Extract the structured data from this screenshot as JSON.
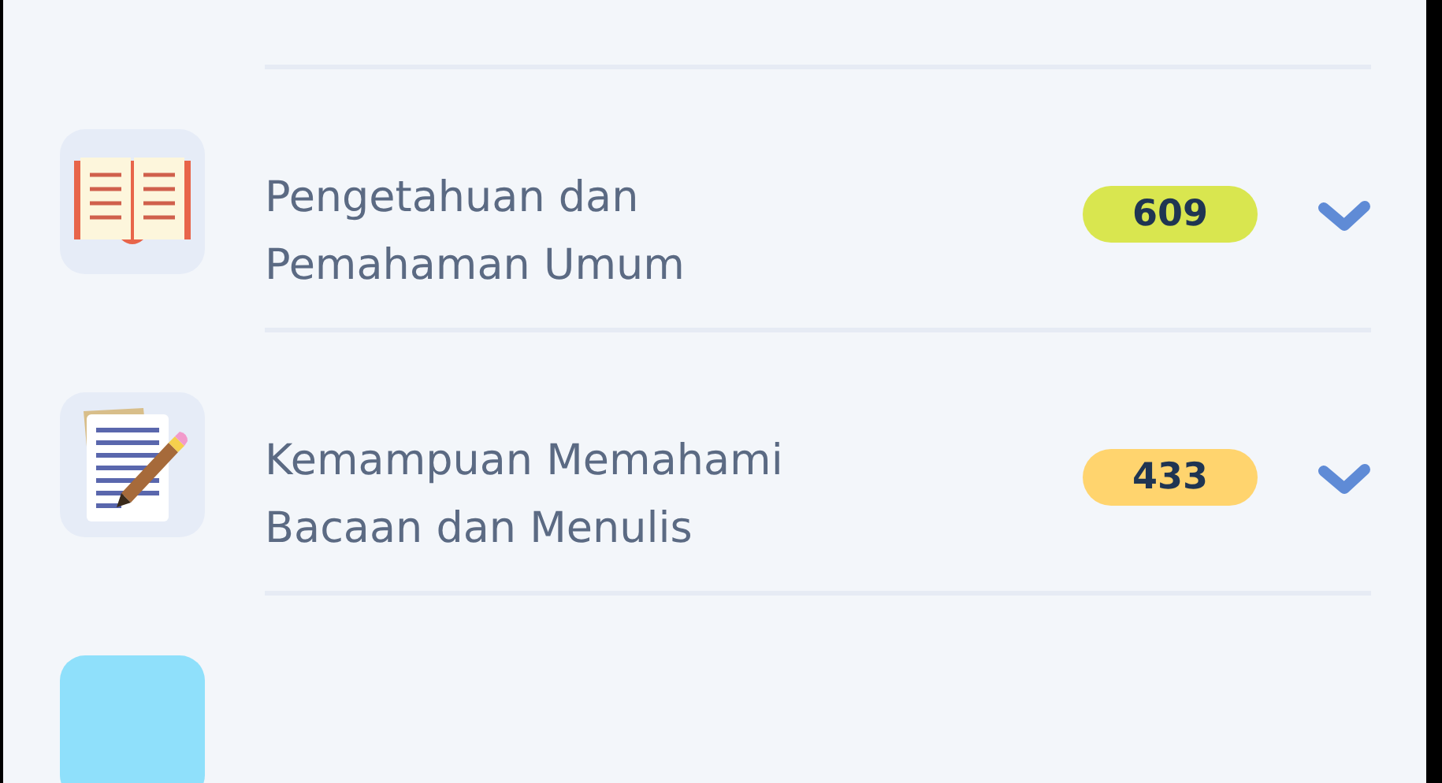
{
  "topics": [
    {
      "kind": "book",
      "title": "Pengetahuan dan\nPemahaman Umum",
      "count": "609",
      "color": "#d9e64f"
    },
    {
      "kind": "writing",
      "title": "Kemampuan Memahami\nBacaan dan Menulis",
      "count": "433",
      "color": "#ffd46e"
    }
  ]
}
